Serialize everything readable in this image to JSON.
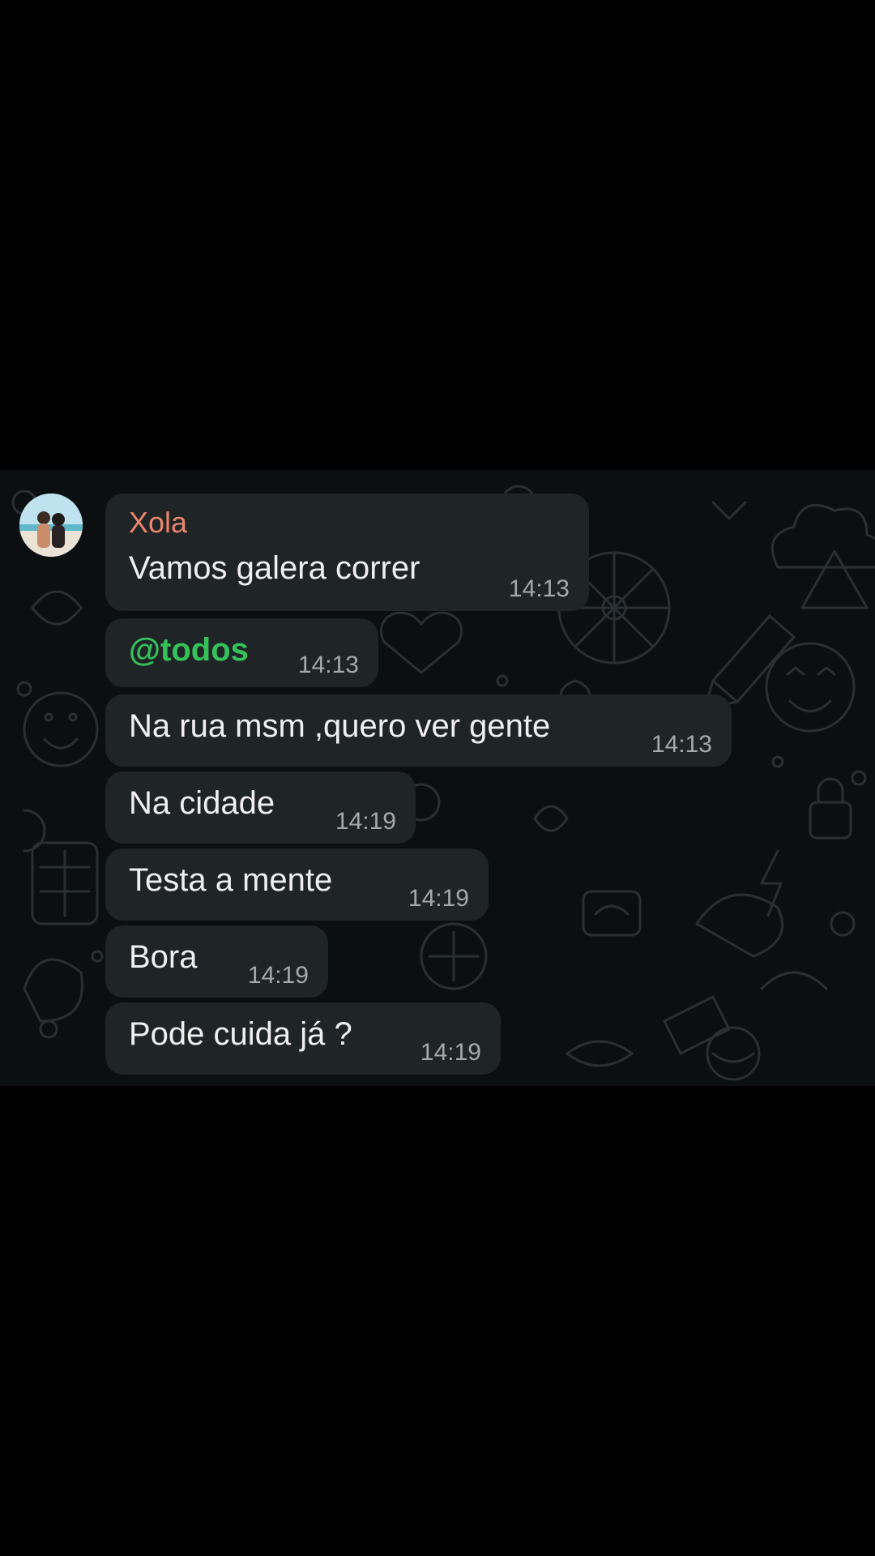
{
  "chat": {
    "sender_name": "Xola",
    "accent_colors": {
      "sender": "#e9866c",
      "mention": "#35c25a",
      "bubble": "#1f2427",
      "background": "#0b0f12"
    },
    "messages": [
      {
        "text": "Vamos galera correr",
        "time": "14:13"
      },
      {
        "text": "@todos",
        "time": "14:13"
      },
      {
        "text": "Na rua msm ,quero ver gente",
        "time": "14:13"
      },
      {
        "text": "Na cidade",
        "time": "14:19"
      },
      {
        "text": "Testa a mente",
        "time": "14:19"
      },
      {
        "text": "Bora",
        "time": "14:19"
      },
      {
        "text": "Pode cuida já ?",
        "time": "14:19"
      }
    ]
  }
}
